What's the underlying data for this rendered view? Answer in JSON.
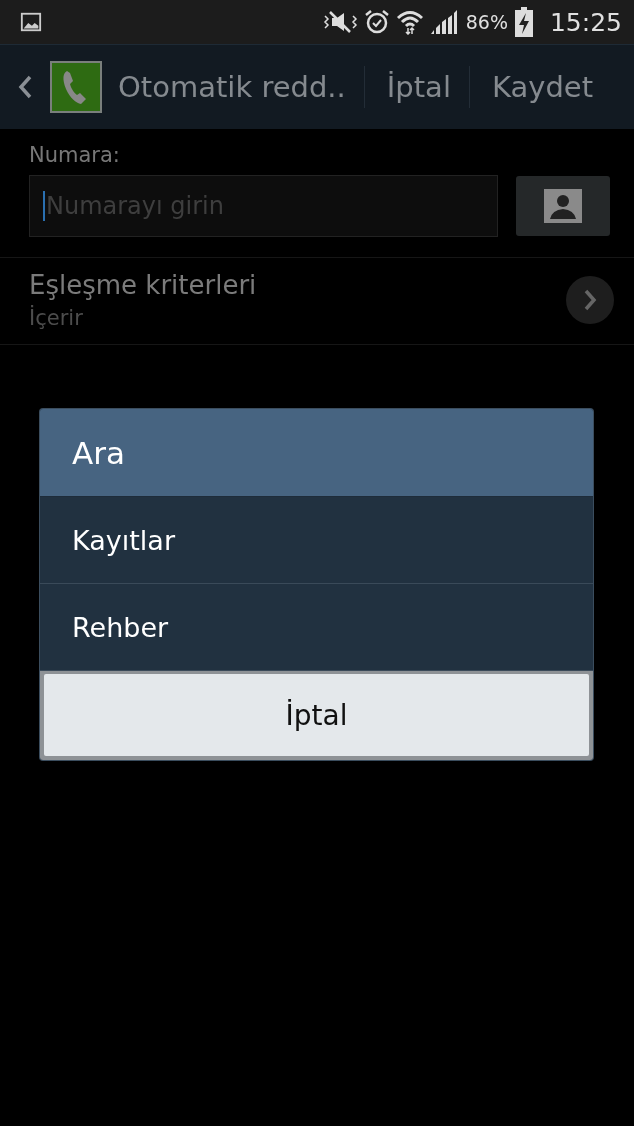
{
  "status_bar": {
    "battery": "86%",
    "time": "15:25"
  },
  "action_bar": {
    "title": "Otomatik redd..",
    "actions": [
      "İptal",
      "Kaydet"
    ]
  },
  "number_field": {
    "label": "Numara:",
    "placeholder": "Numarayı girin"
  },
  "match_setting": {
    "title": "Eşleşme kriterleri",
    "value": "İçerir"
  },
  "dialog": {
    "title": "Ara",
    "items": [
      "Kayıtlar",
      "Rehber"
    ],
    "cancel": "İptal"
  }
}
